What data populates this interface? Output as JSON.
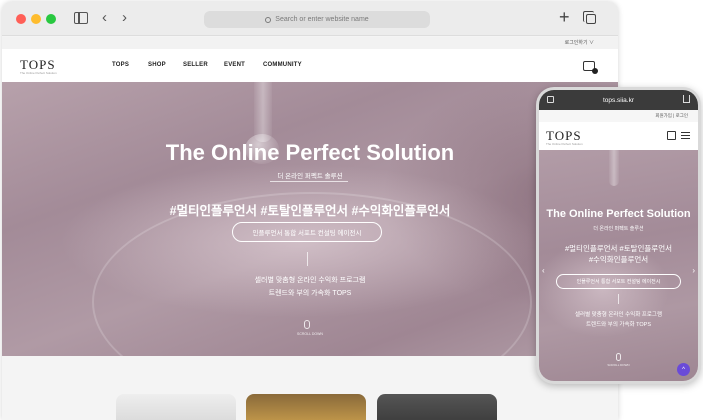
{
  "browser": {
    "url_placeholder": "Search or enter website name",
    "back_glyph": "‹",
    "forward_glyph": "›",
    "new_tab_glyph": "+"
  },
  "site": {
    "language": "로그인하기 ∨",
    "logo": "TOPS",
    "logo_sub": "The Online Perfect Solution",
    "nav": [
      "TOPS",
      "SHOP",
      "SELLER",
      "EVENT",
      "COMMUNITY"
    ]
  },
  "hero": {
    "title": "The Online Perfect Solution",
    "subtitle": "더 온라인 퍼펙트 솔루션",
    "tags": "#멀티인플루언서 #토탈인플루언서 #수익화인플루언서",
    "button": "인플루언서 통합 서포트 컨설팅 에이전시",
    "desc_line1": "셀러별 맞춤형 온라인 수익화 프로그램",
    "desc_line2": "트렌드와 부의 가속화 TOPS",
    "scroll": "SCROLL DOWN"
  },
  "mobile": {
    "url": "tops.siia.kr",
    "top_links": "회원가입 | 로그인",
    "logo": "TOPS",
    "logo_sub": "The Online Perfect Solution",
    "title": "The Online Perfect Solution",
    "subtitle": "더 온라인 퍼펙트 솔루션",
    "tags_line1": "#멀티인플루언서 #토탈인플루언서",
    "tags_line2": "#수익화인플루언서",
    "button": "인플루언서 통합 서포트 컨설팅 에이전시",
    "desc_line1": "셀러별 맞춤형 온라인 수익화 프로그램",
    "desc_line2": "트렌드와 부의 가속화 TOPS",
    "scroll": "SCROLL DOWN",
    "left_arrow": "‹",
    "right_arrow": "›",
    "fab_glyph": "^"
  },
  "colors": {
    "accent_fab": "#6a4bd8",
    "hero_tint": "#a38b98"
  }
}
